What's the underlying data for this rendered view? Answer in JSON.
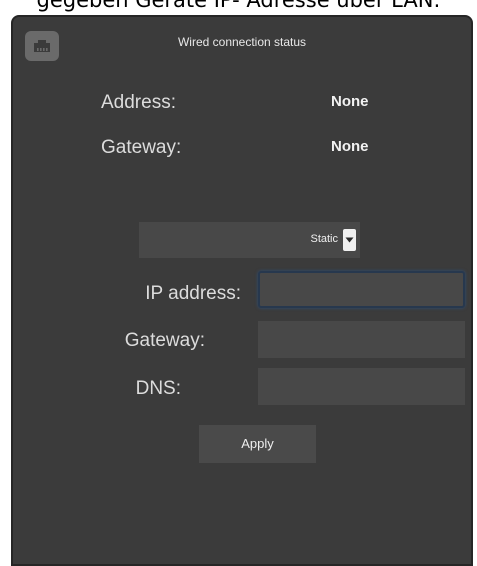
{
  "caption": "gegeben Geräte IP- Adresse über LAN:",
  "panel": {
    "title": "Wired connection status",
    "status": [
      {
        "label": "Address:",
        "value": "None"
      },
      {
        "label": "Gateway:",
        "value": "None"
      }
    ],
    "mode_select": {
      "value": "Static"
    },
    "fields": [
      {
        "label": "IP address:",
        "value": ""
      },
      {
        "label": "Gateway:",
        "value": ""
      },
      {
        "label": "DNS:",
        "value": ""
      }
    ],
    "apply_label": "Apply"
  },
  "colors": {
    "panel_bg": "#3b3b3b",
    "input_bg": "#484848",
    "focus_border": "#27384e",
    "text": "#dcdcdc"
  }
}
